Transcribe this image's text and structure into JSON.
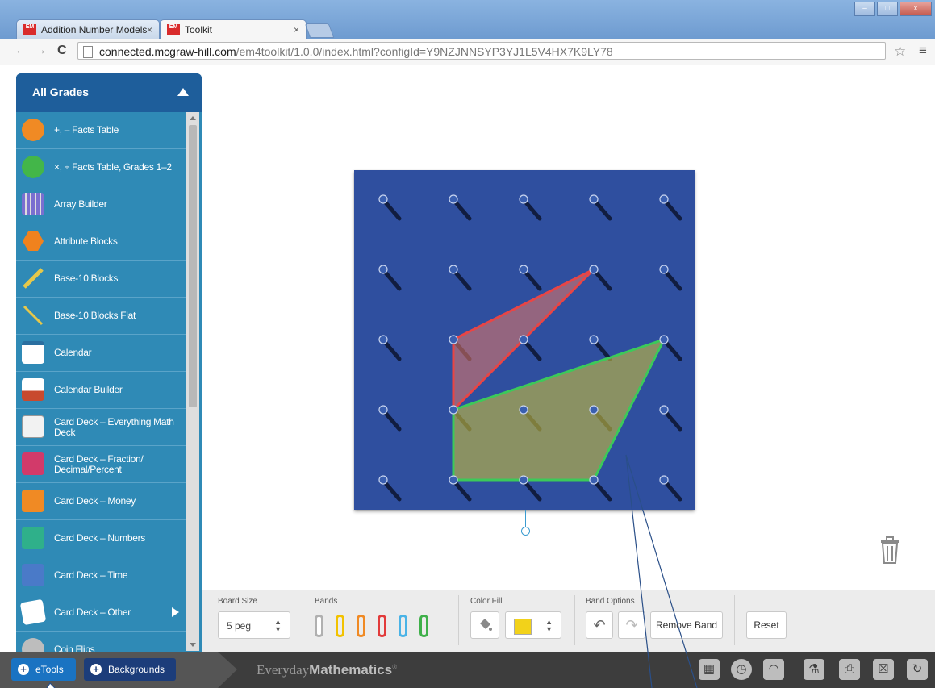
{
  "browser": {
    "tabs": [
      {
        "label": "Addition Number Models",
        "favicon": "EM"
      },
      {
        "label": "Toolkit",
        "favicon": "EM"
      }
    ],
    "url_host": "connected.mcgraw-hill.com",
    "url_path": "/em4toolkit/1.0.0/index.html?configId=Y9NZJNNSYP3YJ1L5V4HX7K9LY78",
    "close_glyph": "×"
  },
  "sidebar": {
    "title": "All Grades",
    "items": [
      {
        "label": "+, – Facts Table",
        "icon": "plus-minus-icon",
        "color": "#f08a24"
      },
      {
        "label": "×, ÷ Facts Table, Grades 1–2",
        "icon": "times-divide-icon",
        "color": "#43b649"
      },
      {
        "label": "Array Builder",
        "icon": "array-icon",
        "color": "#6b5fb5"
      },
      {
        "label": "Attribute Blocks",
        "icon": "hexagon-icon",
        "color": "#f0821e"
      },
      {
        "label": "Base-10 Blocks",
        "icon": "ruler-icon",
        "color": "#e6c84a"
      },
      {
        "label": "Base-10 Blocks Flat",
        "icon": "stick-icon",
        "color": "#e6c84a"
      },
      {
        "label": "Calendar",
        "icon": "calendar-icon",
        "color": "#ffffff"
      },
      {
        "label": "Calendar Builder",
        "icon": "calendar-builder-icon",
        "color": "#c84a2e"
      },
      {
        "label": "Card Deck – Everything Math Deck",
        "icon": "card-icon",
        "color": "#ffffff"
      },
      {
        "label": "Card Deck – Fraction/ Decimal/Percent",
        "icon": "card-fraction-icon",
        "color": "#d23a6a"
      },
      {
        "label": "Card Deck – Money",
        "icon": "card-money-icon",
        "color": "#f08a24"
      },
      {
        "label": "Card Deck – Numbers",
        "icon": "card-numbers-icon",
        "color": "#2fb08a"
      },
      {
        "label": "Card Deck – Time",
        "icon": "card-time-icon",
        "color": "#4a7ac8"
      },
      {
        "label": "Card Deck – Other",
        "icon": "cards-icon",
        "color": "#ffffff"
      },
      {
        "label": "Coin Flips",
        "icon": "coin-icon",
        "color": "#bdbdbd"
      }
    ]
  },
  "toolbar": {
    "board_size_label": "Board Size",
    "board_size_value": "5 peg",
    "bands_label": "Bands",
    "band_colors": [
      "#ffffff",
      "#f2c200",
      "#f08a24",
      "#e23b3b",
      "#4ab3e6",
      "#3fb04a"
    ],
    "color_fill_label": "Color Fill",
    "color_fill_value": "#f2d21a",
    "band_options_label": "Band Options",
    "remove_band_label": "Remove Band",
    "reset_label": "Reset",
    "updown_glyph": "▲▼"
  },
  "bottombar": {
    "etools_label": "eTools",
    "backgrounds_label": "Backgrounds",
    "brand_light": "Everyday",
    "brand_bold": "Mathematics",
    "brand_mark": "®",
    "tools": [
      "calculator-icon",
      "clock-icon",
      "protractor-icon",
      "stamp-icon",
      "print-icon",
      "close-box-icon",
      "refresh-icon"
    ]
  },
  "geoboard": {
    "pegs_per_side": 5,
    "red_band_pegs": [
      [
        1,
        2
      ],
      [
        3,
        1
      ],
      [
        1,
        3
      ]
    ],
    "green_band_pegs": [
      [
        1,
        3
      ],
      [
        4,
        2
      ],
      [
        3,
        4
      ],
      [
        1,
        4
      ]
    ],
    "red_color": "#e84545",
    "green_color": "#3cc95a"
  }
}
